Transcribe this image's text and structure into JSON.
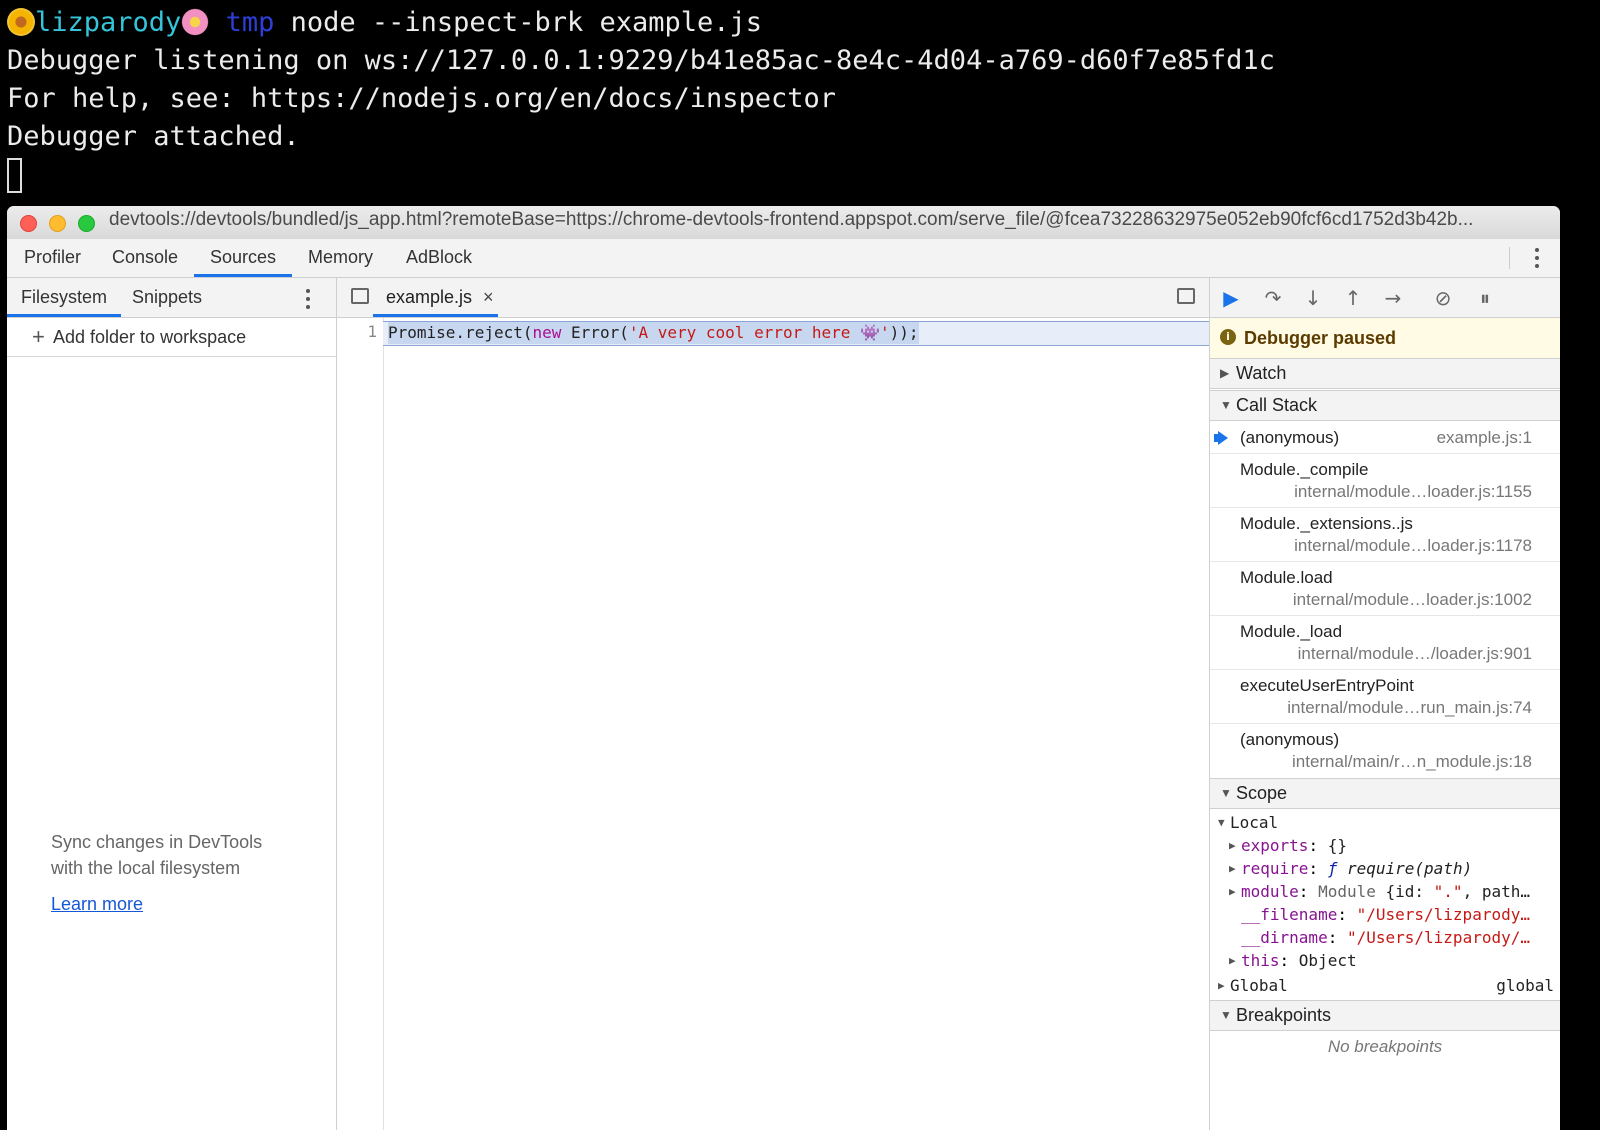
{
  "terminal": {
    "user": "lizparody",
    "dir": "tmp",
    "command": " node --inspect-brk example.js",
    "lines": [
      "Debugger listening on ws://127.0.0.1:9229/b41e85ac-8e4c-4d04-a769-d60f7e85fd1c",
      "For help, see: https://nodejs.org/en/docs/inspector",
      "Debugger attached."
    ]
  },
  "window": {
    "url": "devtools://devtools/bundled/js_app.html?remoteBase=https://chrome-devtools-frontend.appspot.com/serve_file/@fcea73228632975e052eb90fcf6cd1752d3b42b..."
  },
  "main_tabs": [
    "Profiler",
    "Console",
    "Sources",
    "Memory",
    "AdBlock"
  ],
  "active_main_tab": "Sources",
  "navigator": {
    "tabs": [
      "Filesystem",
      "Snippets"
    ],
    "add_folder": "Add folder to workspace",
    "sync_line1": "Sync changes in DevTools",
    "sync_line2": "with the local filesystem",
    "learn_more": "Learn more"
  },
  "editor": {
    "file_tab": "example.js",
    "close_glyph": "×",
    "line_number": "1",
    "code": {
      "a": "Promise.reject(",
      "kw": "new",
      "b": " Error(",
      "str": "'A very cool error here 👾'",
      "c": "));"
    }
  },
  "debugger": {
    "paused": "Debugger paused",
    "sections": {
      "watch": "Watch",
      "call_stack": "Call Stack",
      "scope": "Scope",
      "breakpoints": "Breakpoints"
    },
    "call_stack": [
      {
        "fn": "(anonymous)",
        "loc": "example.js:1"
      },
      {
        "fn": "Module._compile",
        "loc": "internal/module…loader.js:1155"
      },
      {
        "fn": "Module._extensions..js",
        "loc": "internal/module…loader.js:1178"
      },
      {
        "fn": "Module.load",
        "loc": "internal/module…loader.js:1002"
      },
      {
        "fn": "Module._load",
        "loc": "internal/module…/loader.js:901"
      },
      {
        "fn": "executeUserEntryPoint",
        "loc": "internal/module…run_main.js:74"
      },
      {
        "fn": "(anonymous)",
        "loc": "internal/main/r…n_module.js:18"
      }
    ],
    "scope": {
      "local_label": "Local",
      "exports": {
        "key": "exports",
        "val": "{}"
      },
      "require": {
        "key": "require",
        "f": "ƒ",
        "val": "require(path)"
      },
      "module": {
        "key": "module",
        "type": "Module",
        "pre": " {id: ",
        "id": "\".\"",
        "post": ", path…"
      },
      "filename": {
        "key": "__filename",
        "val": "\"/Users/lizparody…"
      },
      "dirname": {
        "key": "__dirname",
        "val": "\"/Users/lizparody/…"
      },
      "this": {
        "key": "this",
        "val": "Object"
      },
      "global_label": "Global",
      "global_val": "global"
    },
    "no_breakpoints": "No breakpoints"
  },
  "colors": {
    "accent": "#1a73e8",
    "paused_bg": "#fffbe5",
    "terminal_user": "#35c4d9",
    "terminal_dir": "#2c3fd8"
  }
}
